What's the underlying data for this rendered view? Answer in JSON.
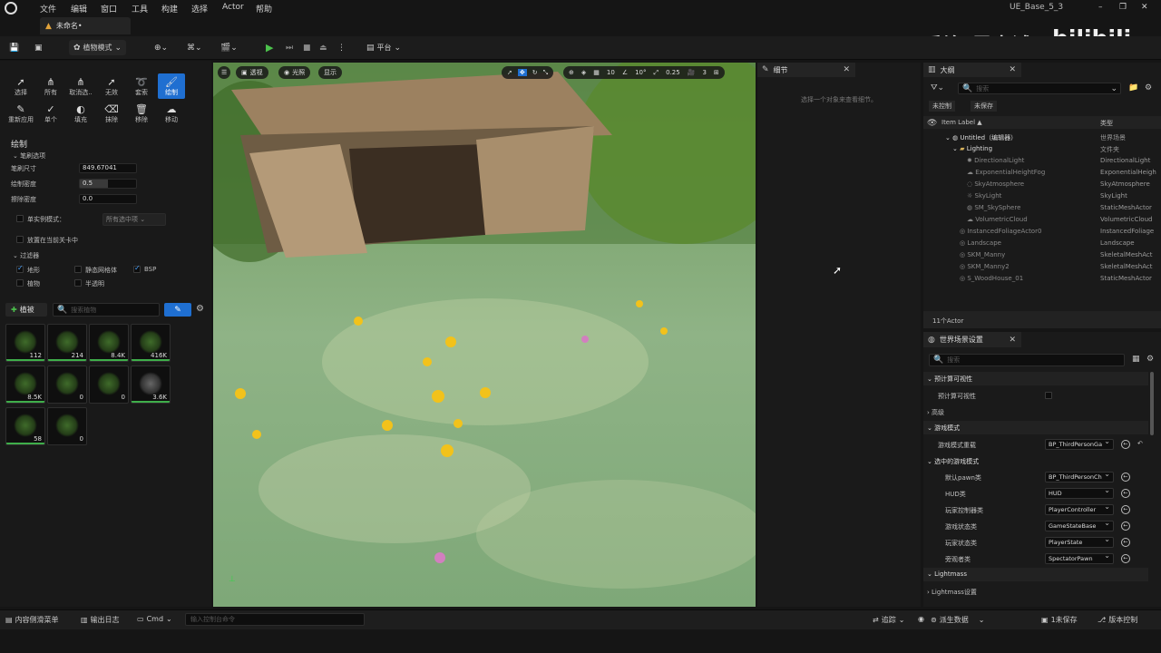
{
  "menubar": {
    "items": [
      "文件",
      "编辑",
      "窗口",
      "工具",
      "构建",
      "选择",
      "Actor",
      "帮助"
    ],
    "project": "UE_Base_5_3"
  },
  "tab": {
    "title": "未命名•"
  },
  "toolbar": {
    "mode": "植物模式",
    "platform": "平台"
  },
  "watermark": {
    "author": "乔治-周士诚",
    "site": "bilibili"
  },
  "foliage_tools": {
    "row1": [
      "选择",
      "所有",
      "取消选..",
      "无效",
      "套索",
      "绘制"
    ],
    "row2": [
      "重新应用",
      "单个",
      "填充",
      "抹除",
      "移除",
      "移动"
    ]
  },
  "paint": {
    "section": "绘制",
    "brush_options": "笔刷选项",
    "brush_size_label": "笔刷尺寸",
    "brush_size": "849.67041",
    "paint_density_label": "绘制密度",
    "paint_density": "0.5",
    "erase_density_label": "擦除密度",
    "erase_density": "0.0",
    "single_instance_label": "单实例模式：",
    "single_instance_value": "所有选中项",
    "place_current_level": "放置在当前关卡中",
    "filters": "过滤器",
    "filter_items": [
      "地形",
      "静态网格体",
      "BSP",
      "植物",
      "半透明"
    ]
  },
  "foliage": {
    "add_label": "植被",
    "search_placeholder": "搜索植物",
    "counts": [
      "112",
      "214",
      "8.4K",
      "416K",
      "8.5K",
      "0",
      "0",
      "3.6K",
      "58",
      "0"
    ]
  },
  "viewport": {
    "perspective": "透视",
    "lit": "光照",
    "show": "显示",
    "grid": "10",
    "angle": "10°",
    "scale": "0.25",
    "camera": "3"
  },
  "details": {
    "title": "细节",
    "empty": "选择一个对象来查看细节。"
  },
  "outliner": {
    "title": "大纲",
    "search_placeholder": "搜索",
    "unsaved1": "未控制",
    "unsaved2": "未保存",
    "col_label": "Item Label ▲",
    "col_type": "类型",
    "rows": [
      {
        "name": "Untitled（编辑器）",
        "type": "世界场景"
      },
      {
        "name": "Lighting",
        "type": "文件夹"
      },
      {
        "name": "DirectionalLight",
        "type": "DirectionalLight"
      },
      {
        "name": "ExponentialHeightFog",
        "type": "ExponentialHeigh"
      },
      {
        "name": "SkyAtmosphere",
        "type": "SkyAtmosphere"
      },
      {
        "name": "SkyLight",
        "type": "SkyLight"
      },
      {
        "name": "SM_SkySphere",
        "type": "StaticMeshActor"
      },
      {
        "name": "VolumetricCloud",
        "type": "VolumetricCloud"
      },
      {
        "name": "InstancedFoliageActor0",
        "type": "InstancedFoliage"
      },
      {
        "name": "Landscape",
        "type": "Landscape"
      },
      {
        "name": "SKM_Manny",
        "type": "SkeletalMeshAct"
      },
      {
        "name": "SKM_Manny2",
        "type": "SkeletalMeshAct"
      },
      {
        "name": "S_WoodHouse_01",
        "type": "StaticMeshActor"
      }
    ],
    "count": "11个Actor"
  },
  "world_settings": {
    "title": "世界场景设置",
    "search_placeholder": "搜索",
    "precomputed": "预计算可视性",
    "precomputed_item": "预计算可视性",
    "advanced": "高级",
    "game_mode": "游戏模式",
    "game_mode_override": "游戏模式重载",
    "game_mode_override_value": "BP_ThirdPersonGa",
    "selected_game_mode": "选中的游戏模式",
    "props": [
      {
        "name": "默认pawn类",
        "value": "BP_ThirdPersonCh"
      },
      {
        "name": "HUD类",
        "value": "HUD"
      },
      {
        "name": "玩家控制器类",
        "value": "PlayerController"
      },
      {
        "name": "游戏状态类",
        "value": "GameStateBase"
      },
      {
        "name": "玩家状态类",
        "value": "PlayerState"
      },
      {
        "name": "旁观者类",
        "value": "SpectatorPawn"
      }
    ],
    "lightmass": "Lightmass",
    "lightmass_settings": "Lightmass设置"
  },
  "statusbar": {
    "content_drawer": "内容侧滑菜单",
    "output_log": "输出日志",
    "cmd": "Cmd",
    "console_placeholder": "输入控制台命令",
    "trace": "追踪",
    "derived_data": "派生数据",
    "unsaved": "1未保存",
    "source_control": "版本控制"
  }
}
